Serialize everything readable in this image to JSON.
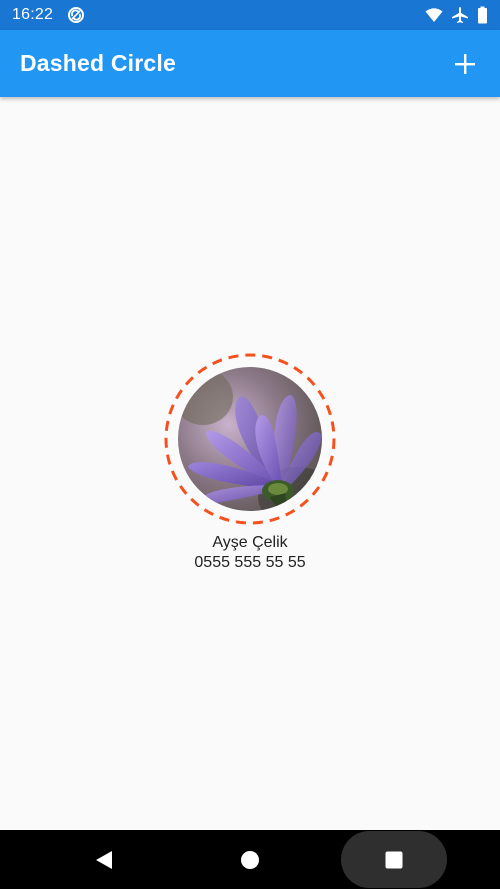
{
  "status_bar": {
    "time": "16:22",
    "icons": [
      "sync-icon",
      "wifi-icon",
      "airplane-icon",
      "battery-icon"
    ]
  },
  "app_bar": {
    "title": "Dashed Circle",
    "action_icon": "add-icon"
  },
  "contact": {
    "name": "Ayşe Çelik",
    "phone": "0555 555 55 55",
    "avatar_image": "purple-flower-photo"
  },
  "navigation": {
    "icons": [
      "back-icon",
      "home-icon",
      "recents-icon"
    ]
  },
  "colors": {
    "status_bar": "#1976d2",
    "app_bar": "#2196f3",
    "background": "#fafafa",
    "dashed_ring": "#f4511e",
    "nav_bar": "#000000"
  }
}
